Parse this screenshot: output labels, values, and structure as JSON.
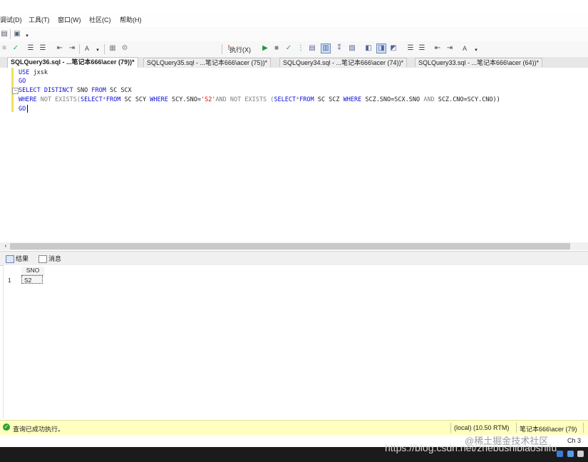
{
  "menu": {
    "items": [
      "调试(D)",
      "工具(T)",
      "窗口(W)",
      "社区(C)",
      "帮助(H)"
    ]
  },
  "toolbar": {
    "database": "jxsk",
    "execute_label": "执行(X)"
  },
  "tabs": [
    {
      "label": "SQLQuery36.sql - ...笔记本666\\acer (79))*"
    },
    {
      "label": "SQLQuery35.sql - ...笔记本666\\acer (75))*"
    },
    {
      "label": "SQLQuery34.sql - ...笔记本666\\acer (74))*"
    },
    {
      "label": "SQLQuery33.sql - ...笔记本666\\acer (64))*"
    }
  ],
  "editor": {
    "l1_kw": "USE",
    "l1_rest": " jxsk",
    "l2": "GO",
    "l3_kw": "SELECT DISTINCT",
    "l3_a": " SNO ",
    "l3_kw2": "FROM",
    "l3_b": " SC SCX",
    "l4_kw": "WHERE",
    "l4_gr": " NOT EXISTS",
    "l4_a": "(",
    "l4_kw2": "SELECT",
    "l4_b": "*",
    "l4_kw3": "FROM",
    "l4_c": " SC SCY ",
    "l4_kw4": "WHERE",
    "l4_d": " SCY.SNO=",
    "l4_str": "'S2'",
    "l4_kw5": "AND NOT EXISTS",
    "l4_e": " (",
    "l4_kw6": "SELECT",
    "l4_f": "*",
    "l4_kw7": "FROM",
    "l4_g": " SC SCZ ",
    "l4_kw8": "WHERE",
    "l4_h": " SCZ.SNO=SCX.SNO ",
    "l4_kw9": "AND",
    "l4_i": " SCZ.CNO=SCY.CNO))",
    "l5": "GO"
  },
  "results_tabs": {
    "results": "结果",
    "messages": "消息"
  },
  "grid": {
    "columns": [
      "SNO"
    ],
    "rows": [
      {
        "num": "1",
        "SNO": "S2"
      }
    ]
  },
  "status": {
    "message": "查询已成功执行。",
    "server": "(local) (10.50 RTM)",
    "connection": "笔记本666\\acer (79)",
    "position": "Ch 3"
  },
  "watermark": {
    "community": "@稀土掘金技术社区",
    "url": "https://blog.csdn.net/zhebushibiaoshifu"
  }
}
